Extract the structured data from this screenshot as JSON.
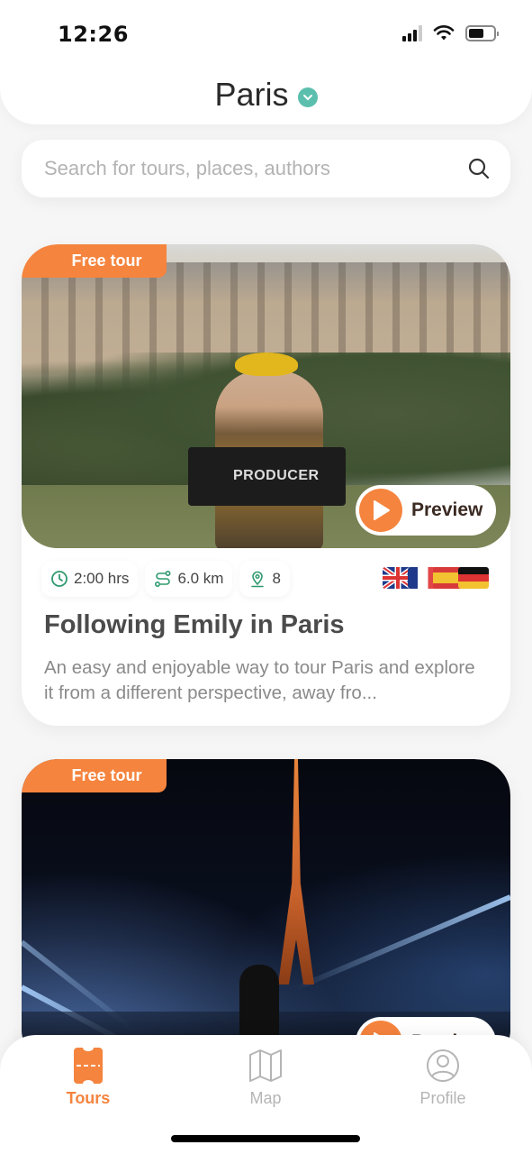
{
  "status_bar": {
    "time": "12:26"
  },
  "header": {
    "city": "Paris"
  },
  "search": {
    "placeholder": "Search for tours, places, authors",
    "value": ""
  },
  "tours": [
    {
      "badge": "Free tour",
      "preview_label": "Preview",
      "duration": "2:00 hrs",
      "distance": "6.0 km",
      "stops": "8",
      "languages": [
        "English",
        "French",
        "Spanish",
        "German"
      ],
      "title": "Following Emily in Paris",
      "description": "An easy and enjoyable way to tour Paris and explore it from a different perspective, away fro...",
      "image_label": "PRODUCER"
    },
    {
      "badge": "Free tour",
      "preview_label": "Preview"
    }
  ],
  "bottom_nav": {
    "items": [
      {
        "label": "Tours",
        "icon": "ticket-icon",
        "active": true
      },
      {
        "label": "Map",
        "icon": "map-icon",
        "active": false
      },
      {
        "label": "Profile",
        "icon": "profile-icon",
        "active": false
      }
    ]
  },
  "colors": {
    "accent": "#f5843e",
    "teal": "#5cbfae",
    "meta_icon": "#2e9a6e"
  }
}
